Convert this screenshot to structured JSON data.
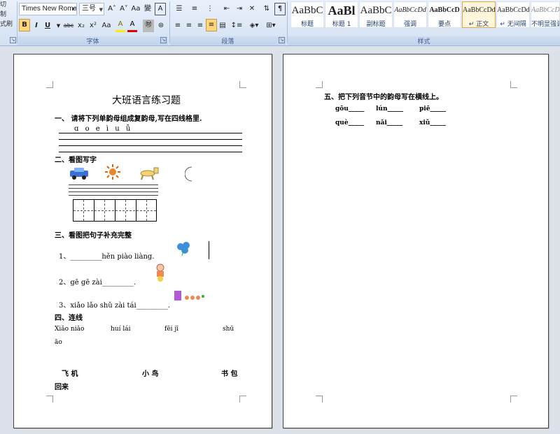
{
  "ribbon": {
    "clipboard_items": [
      "切",
      "制",
      "式刷"
    ],
    "font": {
      "name": "Times New Romar",
      "size": "三号",
      "buttons": [
        "A˄",
        "A˅",
        "Aa",
        "變",
        "A"
      ],
      "format_buttons": [
        "B",
        "I",
        "U",
        "abc",
        "x₂",
        "x²",
        "Aa",
        "A",
        "A",
        "㊖"
      ],
      "group_label": "字体"
    },
    "paragraph": {
      "group_label": "段落"
    },
    "styles": {
      "group_label": "样式",
      "items": [
        {
          "sample": "AaBbC",
          "name": "标题"
        },
        {
          "sample": "AaBl",
          "name": "标题 1"
        },
        {
          "sample": "AaBbC",
          "name": "副标题"
        },
        {
          "sample": "AaBbCcDd",
          "name": "强调"
        },
        {
          "sample": "AaBbCcD",
          "name": "要点"
        },
        {
          "sample": "AaBbCcDd",
          "name": "↵ 正文"
        },
        {
          "sample": "AaBbCcDd",
          "name": "↵ 无间隔"
        },
        {
          "sample": "AaBbCcDd",
          "name": "不明显强调"
        }
      ]
    }
  },
  "page1": {
    "title": "大班语言练习题",
    "q1": "一、 请将下列单韵母组成复韵母,写在四线格里.",
    "q1_letters": "ɑ  o  e  ì  u  ǖ",
    "q2": "二、看图写字",
    "q3": "三、看图把句子补充完整",
    "q3_1": "1、_________hěn  piào  liàng.",
    "q3_2": "2、gē gē zài_________.",
    "q3_3": "3、xiǎo lǎo shǔ zài tái_________.",
    "q4": "四、连线",
    "pinyin": [
      "Xiǎo niǎo",
      "huí lái",
      "fēi jī",
      "shū"
    ],
    "pinyin_tail": "āo",
    "words": [
      "飞 机",
      "小 鸟",
      "书 包"
    ],
    "word_tail": "回来"
  },
  "page2": {
    "q5": "五、把下列音节中的韵母写在横线上。",
    "row1": [
      "gōu_____",
      "lún_____",
      "piē_____"
    ],
    "row2": [
      "què_____",
      "nǎi_____",
      "xiǔ_____"
    ]
  }
}
